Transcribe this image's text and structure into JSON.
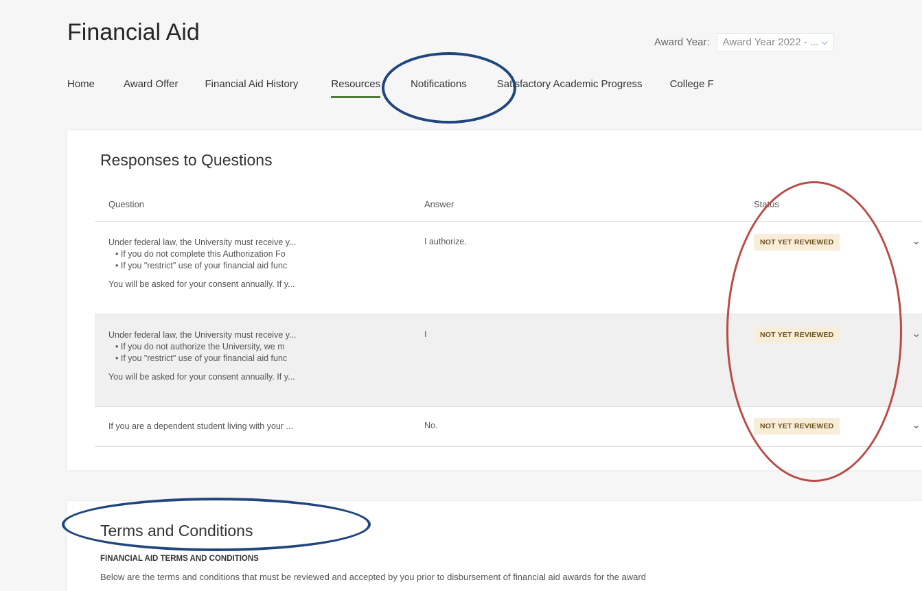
{
  "page": {
    "title": "Financial Aid"
  },
  "award_year": {
    "label": "Award Year:",
    "selected": "Award Year 2022 - ...",
    "chevron_icon": "chevron-down-icon"
  },
  "nav": {
    "items": [
      {
        "label": "Home",
        "active": false
      },
      {
        "label": "Award Offer",
        "active": false
      },
      {
        "label": "Financial Aid History",
        "active": false
      },
      {
        "label": "Resources",
        "active": true
      },
      {
        "label": "Notifications",
        "active": false
      },
      {
        "label": "Satisfactory Academic Progress",
        "active": false
      },
      {
        "label": "College F",
        "active": false
      }
    ],
    "active_underline_color": "#4f7a39"
  },
  "responses": {
    "title": "Responses to Questions",
    "columns": [
      "Question",
      "Answer",
      "Status"
    ],
    "rows": [
      {
        "question": "Under federal law, the University must receive y...",
        "bullets": [
          "If you do not complete this Authorization Fo",
          "If you \"restrict\" use of your financial aid func"
        ],
        "trailing": "You will be asked for your consent annually. If y...",
        "answer": "I authorize.",
        "status": "NOT YET REVIEWED"
      },
      {
        "question": "Under federal law, the University must receive y...",
        "bullets": [
          "If you do not authorize the University, we m",
          "If you \"restrict\" use of your financial aid func"
        ],
        "trailing": "You will be asked for your consent annually. If y...",
        "answer": "I",
        "status": "NOT YET REVIEWED"
      },
      {
        "question": "If you are a dependent student living with your ...",
        "bullets": [],
        "trailing": "",
        "answer": "No.",
        "status": "NOT YET REVIEWED"
      }
    ],
    "status_badge_color": "#f7edd8"
  },
  "terms": {
    "title": "Terms and Conditions",
    "subheading": "FINANCIAL AID TERMS AND CONDITIONS",
    "text": "Below are the terms and conditions that must be reviewed and accepted by you prior to disbursement of financial aid awards for the award"
  },
  "annotations": {
    "blue_color": "#1f467d",
    "red_color": "#bb4a47"
  }
}
